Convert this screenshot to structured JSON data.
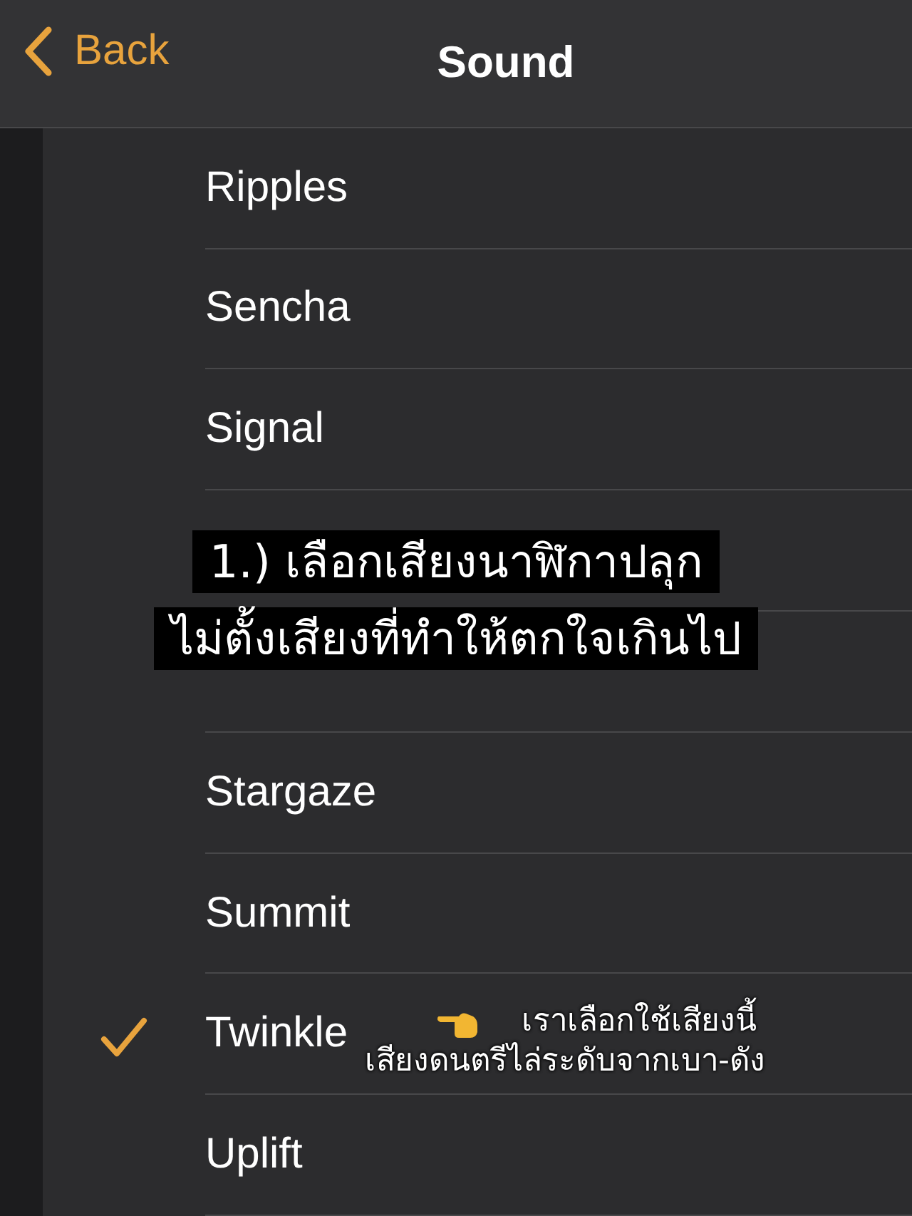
{
  "nav": {
    "back": "Back",
    "title": "Sound"
  },
  "rows": [
    {
      "name": "Ripples",
      "checked": false
    },
    {
      "name": "Sencha",
      "checked": false
    },
    {
      "name": "Signal",
      "checked": false
    },
    {
      "checked": false
    },
    {
      "checked": false
    },
    {
      "name": "Stargaze",
      "checked": false
    },
    {
      "name": "Summit",
      "checked": false
    },
    {
      "name": "Twinkle",
      "checked": true
    },
    {
      "name": "Uplift",
      "checked": false
    }
  ],
  "caption": [
    "1.) เลือกเสียงนาฬิกาปลุก",
    "ไม่ตั้งเสียงที่ทำให้ตกใจเกินไป"
  ],
  "annotation": [
    "เราเลือกใช้เสียงนี้",
    "เสียงดนตรีไล่ระดับจากเบา-ดัง"
  ]
}
